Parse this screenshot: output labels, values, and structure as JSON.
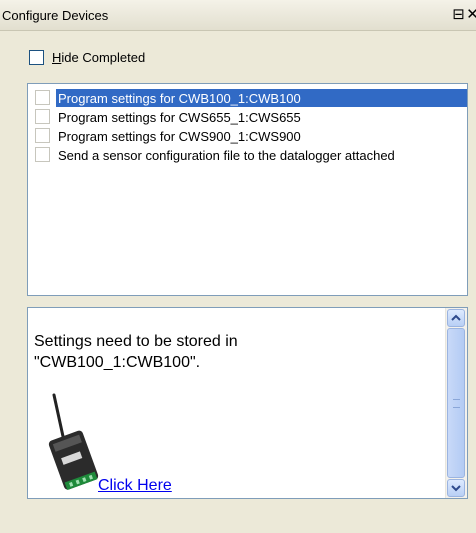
{
  "window": {
    "title": "Configure Devices",
    "restore_glyph": "⊟",
    "close_glyph": "✕"
  },
  "filter": {
    "hide_completed_underline": "H",
    "hide_completed_rest": "ide Completed",
    "checked": false
  },
  "tasks": [
    {
      "label": "Program settings for CWB100_1:CWB100",
      "selected": true
    },
    {
      "label": "Program settings for CWS655_1:CWS655",
      "selected": false
    },
    {
      "label": "Program settings for CWS900_1:CWS900",
      "selected": false
    },
    {
      "label": "Send a sensor configuration file to the datalogger attached",
      "selected": false
    }
  ],
  "info": {
    "message_line1": "Settings need to be stored in",
    "message_line2": "\"CWB100_1:CWB100\".",
    "link_text": "Click Here",
    "icons": {
      "device": "wireless-base-device-icon"
    }
  },
  "colors": {
    "selection": "#316ac5",
    "link": "#0000ee",
    "panel_bg": "#ece9d8"
  }
}
